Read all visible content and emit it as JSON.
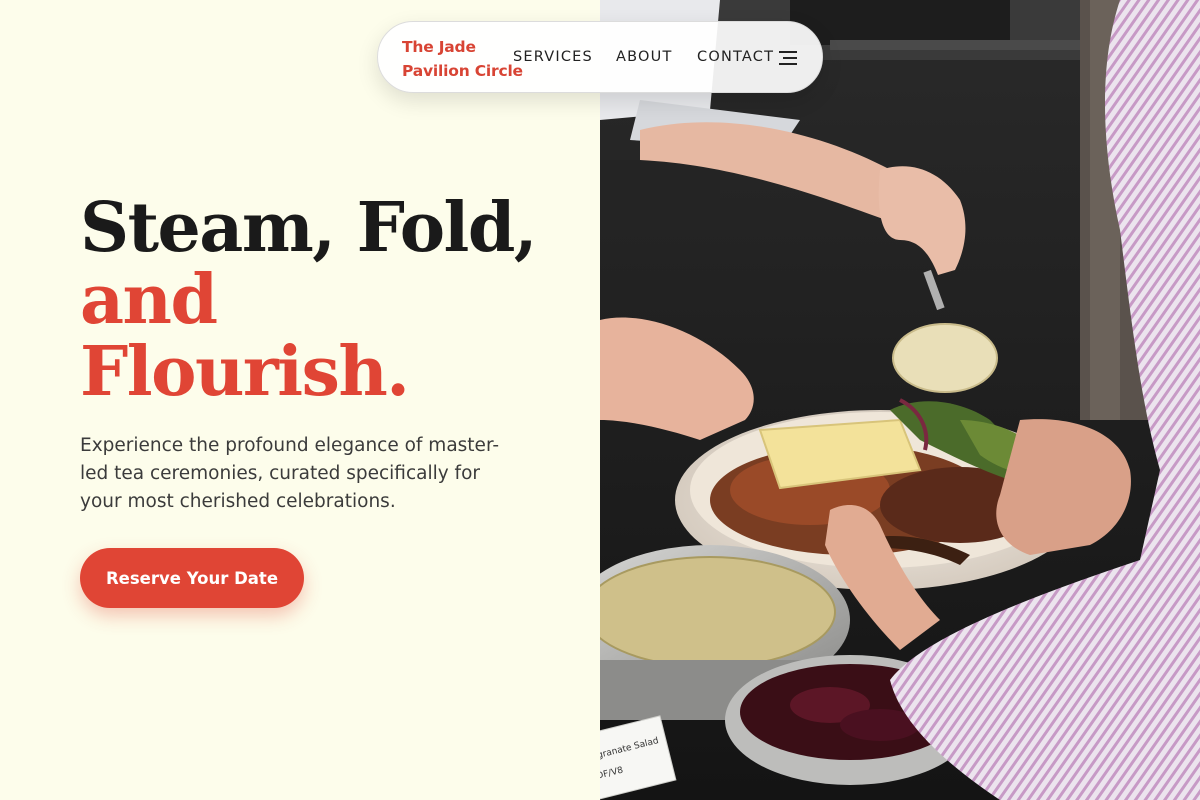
{
  "nav": {
    "brand_line1": "The Jade",
    "brand_line2": "Pavilion Circle",
    "links": [
      "SERVICES",
      "ABOUT",
      "CONTACT"
    ],
    "menu_icon": "menu-icon"
  },
  "hero": {
    "line1": "Steam, Fold,",
    "line2": "and",
    "line3": "Flourish.",
    "subtitle": "Experience the profound elegance of master-led tea ceremonies, curated specifically for your most cherished celebrations.",
    "cta": "Reserve Your Date"
  },
  "photo": {
    "description_icon": "food-serving-photo",
    "card_text_line1": "egranate Salad",
    "card_text_line2": "DF/V8"
  },
  "colors": {
    "accent": "#e04535",
    "background": "#fdfdeb",
    "text": "#1a1a1a"
  }
}
